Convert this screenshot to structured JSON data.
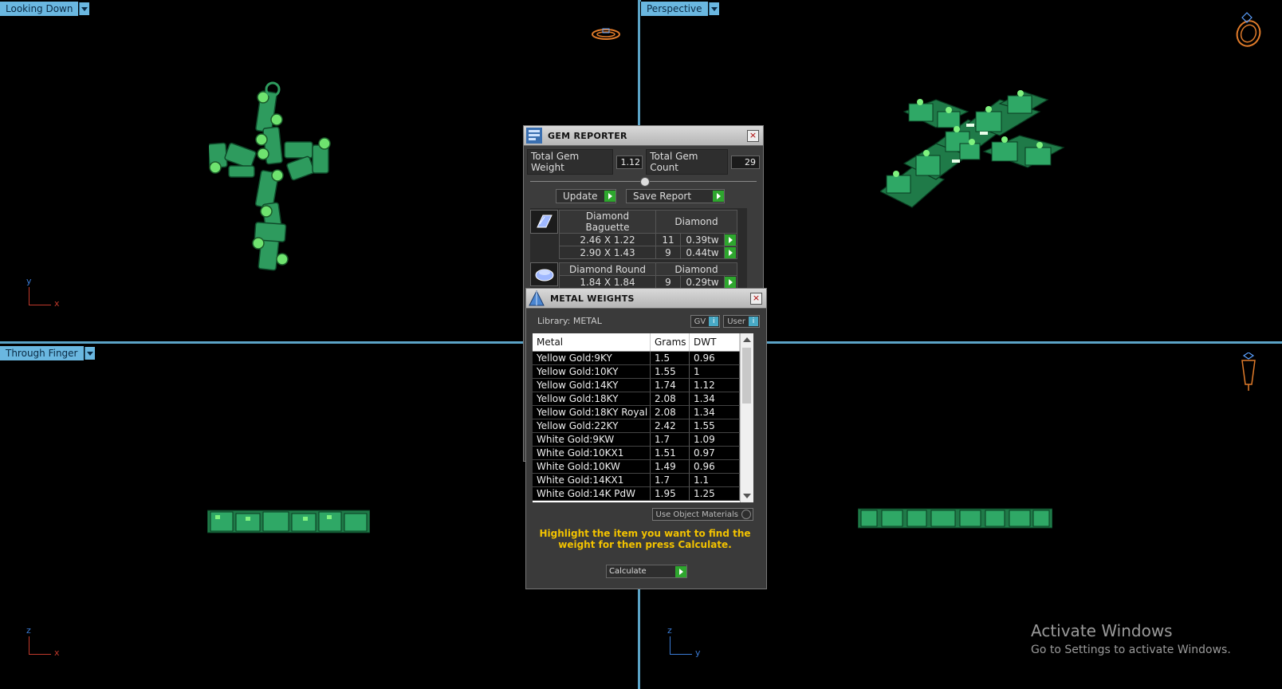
{
  "viewports": {
    "top_left": {
      "label": "Looking Down"
    },
    "top_right": {
      "label": "Perspective"
    },
    "bottom_left": {
      "label": "Through Finger"
    },
    "top_left_axes": {
      "a1": "y",
      "a2": "x"
    },
    "bottom_left_axes": {
      "a1": "z",
      "a2": "x"
    },
    "bottom_right_axes": {
      "a1": "z",
      "a2": "y"
    }
  },
  "gem_reporter": {
    "title": "GEM REPORTER",
    "total_weight_label": "Total Gem Weight",
    "total_weight": "1.12",
    "total_count_label": "Total Gem Count",
    "total_count": "29",
    "update_label": "Update",
    "save_label": "Save Report",
    "groups": [
      {
        "name": "Diamond Baguette",
        "material": "Diamond",
        "rows": [
          {
            "size": "2.46 X 1.22",
            "count": "11",
            "weight": "0.39tw"
          },
          {
            "size": "2.90 X 1.43",
            "count": "9",
            "weight": "0.44tw"
          }
        ]
      },
      {
        "name": "Diamond Round",
        "material": "Diamond",
        "rows": [
          {
            "size": "1.84 X 1.84",
            "count": "9",
            "weight": "0.29tw"
          }
        ]
      }
    ]
  },
  "metal_weights": {
    "title": "METAL WEIGHTS",
    "library_label": "Library: METAL",
    "gv_label": "GV",
    "user_label": "User",
    "columns": [
      "Metal",
      "Grams",
      "DWT"
    ],
    "rows": [
      [
        "Yellow Gold:9KY",
        "1.5",
        "0.96"
      ],
      [
        "Yellow Gold:10KY",
        "1.55",
        "1"
      ],
      [
        "Yellow Gold:14KY",
        "1.74",
        "1.12"
      ],
      [
        "Yellow Gold:18KY",
        "2.08",
        "1.34"
      ],
      [
        "Yellow Gold:18KY Royal",
        "2.08",
        "1.34"
      ],
      [
        "Yellow Gold:22KY",
        "2.42",
        "1.55"
      ],
      [
        "White Gold:9KW",
        "1.7",
        "1.09"
      ],
      [
        "White Gold:10KX1",
        "1.51",
        "0.97"
      ],
      [
        "White Gold:10KW",
        "1.49",
        "0.96"
      ],
      [
        "White Gold:14KX1",
        "1.7",
        "1.1"
      ],
      [
        "White Gold:14K PdW",
        "1.95",
        "1.25"
      ]
    ],
    "use_object_materials": "Use Object Materials",
    "hint": "Highlight the item you want to find the weight for then press Calculate.",
    "calculate_label": "Calculate"
  },
  "watermark": {
    "line1": "Activate Windows",
    "line2": "Go to Settings to activate Windows."
  },
  "colors": {
    "viewport_border": "#5ba3c7",
    "model_green": "#2fa866",
    "go_button": "#2ea62e",
    "hint_text": "#f2c200"
  }
}
